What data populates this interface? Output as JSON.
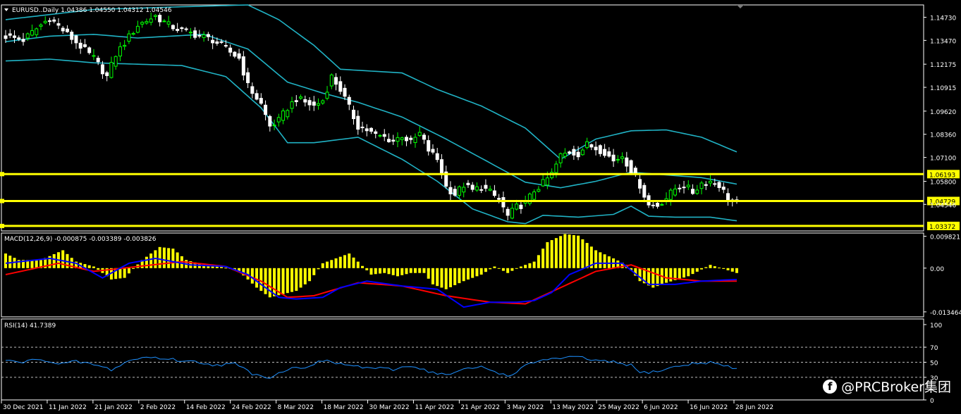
{
  "chart_data": [
    {
      "type": "candlestick",
      "title": "EURUSD..Daily",
      "ohlc_header": "1.04386 1.04550 1.04312 1.04546",
      "indicator": "Bollinger Bands",
      "ylim": [
        1.031,
        1.154
      ],
      "y_ticks": [
        "1.14730",
        "1.13470",
        "1.12175",
        "1.10915",
        "1.09620",
        "1.08360",
        "1.07100",
        "1.05800",
        "1.04546"
      ],
      "x_ticks": [
        "30 Dec 2021",
        "11 Jan 2022",
        "21 Jan 2022",
        "2 Feb 2022",
        "14 Feb 2022",
        "24 Feb 2022",
        "8 Mar 2022",
        "18 Mar 2022",
        "30 Mar 2022",
        "11 Apr 2022",
        "21 Apr 2022",
        "3 May 2022",
        "13 May 2022",
        "25 May 2022",
        "6 Jun 2022",
        "16 Jun 2022",
        "28 Jun 2022"
      ],
      "levels": [
        {
          "label": "1.06193",
          "value": 1.06193
        },
        {
          "label": "1.04729",
          "value": 1.04729
        },
        {
          "label": "1.03372",
          "value": 1.03372
        }
      ],
      "close_anchors": [
        [
          0,
          1.137
        ],
        [
          4,
          1.135
        ],
        [
          10,
          1.147
        ],
        [
          14,
          1.138
        ],
        [
          20,
          1.125
        ],
        [
          23,
          1.115
        ],
        [
          25,
          1.127
        ],
        [
          30,
          1.143
        ],
        [
          34,
          1.148
        ],
        [
          37,
          1.143
        ],
        [
          40,
          1.14
        ],
        [
          43,
          1.138
        ],
        [
          47,
          1.135
        ],
        [
          50,
          1.13
        ],
        [
          53,
          1.125
        ],
        [
          55,
          1.11
        ],
        [
          58,
          1.1
        ],
        [
          60,
          1.088
        ],
        [
          62,
          1.091
        ],
        [
          64,
          1.098
        ],
        [
          66,
          1.103
        ],
        [
          68,
          1.101
        ],
        [
          70,
          1.099
        ],
        [
          72,
          1.102
        ],
        [
          74,
          1.115
        ],
        [
          76,
          1.108
        ],
        [
          78,
          1.098
        ],
        [
          80,
          1.088
        ],
        [
          82,
          1.086
        ],
        [
          84,
          1.083
        ],
        [
          86,
          1.082
        ],
        [
          88,
          1.08
        ],
        [
          90,
          1.083
        ],
        [
          92,
          1.079
        ],
        [
          94,
          1.084
        ],
        [
          96,
          1.075
        ],
        [
          98,
          1.07
        ],
        [
          100,
          1.055
        ],
        [
          102,
          1.051
        ],
        [
          104,
          1.056
        ],
        [
          106,
          1.053
        ],
        [
          108,
          1.055
        ],
        [
          110,
          1.052
        ],
        [
          112,
          1.048
        ],
        [
          114,
          1.039
        ],
        [
          116,
          1.044
        ],
        [
          118,
          1.046
        ],
        [
          120,
          1.053
        ],
        [
          122,
          1.057
        ],
        [
          124,
          1.062
        ],
        [
          126,
          1.072
        ],
        [
          128,
          1.074
        ],
        [
          130,
          1.073
        ],
        [
          132,
          1.078
        ],
        [
          134,
          1.076
        ],
        [
          136,
          1.074
        ],
        [
          138,
          1.069
        ],
        [
          140,
          1.072
        ],
        [
          142,
          1.064
        ],
        [
          144,
          1.056
        ],
        [
          146,
          1.045
        ],
        [
          148,
          1.045
        ],
        [
          150,
          1.049
        ],
        [
          152,
          1.054
        ],
        [
          154,
          1.056
        ],
        [
          156,
          1.052
        ],
        [
          158,
          1.057
        ],
        [
          160,
          1.058
        ],
        [
          162,
          1.056
        ],
        [
          164,
          1.049
        ],
        [
          166,
          1.0455
        ]
      ],
      "bb_upper": [
        [
          0,
          1.146
        ],
        [
          20,
          1.1515
        ],
        [
          40,
          1.153
        ],
        [
          55,
          1.154
        ],
        [
          62,
          1.146
        ],
        [
          70,
          1.132
        ],
        [
          76,
          1.119
        ],
        [
          90,
          1.117
        ],
        [
          98,
          1.108
        ],
        [
          108,
          1.099
        ],
        [
          118,
          1.087
        ],
        [
          126,
          1.07
        ],
        [
          134,
          1.081
        ],
        [
          142,
          1.0855
        ],
        [
          150,
          1.086
        ],
        [
          158,
          1.082
        ],
        [
          166,
          1.074
        ]
      ],
      "bb_lower": [
        [
          0,
          1.1235
        ],
        [
          10,
          1.1245
        ],
        [
          20,
          1.1225
        ],
        [
          40,
          1.121
        ],
        [
          50,
          1.115
        ],
        [
          58,
          1.098
        ],
        [
          64,
          1.079
        ],
        [
          70,
          1.079
        ],
        [
          80,
          1.082
        ],
        [
          90,
          1.07
        ],
        [
          98,
          1.058
        ],
        [
          106,
          1.043
        ],
        [
          114,
          1.036
        ],
        [
          118,
          1.035
        ],
        [
          122,
          1.0395
        ],
        [
          130,
          1.0385
        ],
        [
          138,
          1.04
        ],
        [
          142,
          1.0445
        ],
        [
          146,
          1.039
        ],
        [
          152,
          1.0385
        ],
        [
          160,
          1.0385
        ],
        [
          166,
          1.0365
        ]
      ],
      "bb_middle": [
        [
          0,
          1.134
        ],
        [
          10,
          1.137
        ],
        [
          20,
          1.138
        ],
        [
          30,
          1.136
        ],
        [
          45,
          1.138
        ],
        [
          55,
          1.13
        ],
        [
          64,
          1.112
        ],
        [
          72,
          1.106
        ],
        [
          80,
          1.101
        ],
        [
          90,
          1.093
        ],
        [
          100,
          1.081
        ],
        [
          110,
          1.068
        ],
        [
          118,
          1.0575
        ],
        [
          126,
          1.0545
        ],
        [
          134,
          1.058
        ],
        [
          142,
          1.063
        ],
        [
          150,
          1.0615
        ],
        [
          158,
          1.06
        ],
        [
          166,
          1.0565
        ]
      ]
    },
    {
      "type": "macd",
      "title": "MACD(12,26,9) -0.000875 -0.003389 -0.003826",
      "ylim": [
        -0.015,
        0.0108
      ],
      "y_ticks": [
        "0.009821",
        "0.00",
        "-0.013464"
      ],
      "hist_anchors": [
        [
          0,
          0.0045
        ],
        [
          3,
          0.0025
        ],
        [
          8,
          0.0025
        ],
        [
          13,
          0.0055
        ],
        [
          16,
          0.002
        ],
        [
          20,
          0.0005
        ],
        [
          24,
          -0.0035
        ],
        [
          27,
          -0.003
        ],
        [
          31,
          0.0025
        ],
        [
          35,
          0.0065
        ],
        [
          38,
          0.006
        ],
        [
          41,
          0.0025
        ],
        [
          45,
          0.001
        ],
        [
          49,
          0.0005
        ],
        [
          53,
          -0.001
        ],
        [
          57,
          -0.006
        ],
        [
          60,
          -0.009
        ],
        [
          63,
          -0.008
        ],
        [
          66,
          -0.007
        ],
        [
          69,
          -0.004
        ],
        [
          72,
          0.0015
        ],
        [
          75,
          0.003
        ],
        [
          78,
          0.0045
        ],
        [
          80,
          0.002
        ],
        [
          83,
          -0.002
        ],
        [
          86,
          -0.0015
        ],
        [
          89,
          -0.0025
        ],
        [
          92,
          -0.0015
        ],
        [
          95,
          -0.0015
        ],
        [
          97,
          -0.005
        ],
        [
          100,
          -0.0065
        ],
        [
          104,
          -0.004
        ],
        [
          108,
          -0.002
        ],
        [
          111,
          0.0005
        ],
        [
          114,
          -0.0015
        ],
        [
          117,
          0.0005
        ],
        [
          120,
          0.002
        ],
        [
          123,
          0.008
        ],
        [
          127,
          0.0105
        ],
        [
          130,
          0.01
        ],
        [
          134,
          0.0055
        ],
        [
          138,
          0.003
        ],
        [
          141,
          0.001
        ],
        [
          144,
          -0.004
        ],
        [
          147,
          -0.006
        ],
        [
          150,
          -0.0045
        ],
        [
          155,
          -0.0025
        ],
        [
          160,
          0.001
        ],
        [
          166,
          -0.0015
        ]
      ],
      "macd_line": [
        [
          0,
          0.0015
        ],
        [
          10,
          0.003
        ],
        [
          16,
          0.0015
        ],
        [
          22,
          -0.003
        ],
        [
          28,
          0.0015
        ],
        [
          34,
          0.003
        ],
        [
          42,
          0.001
        ],
        [
          50,
          0.0005
        ],
        [
          55,
          -0.002
        ],
        [
          62,
          -0.009
        ],
        [
          66,
          -0.0095
        ],
        [
          72,
          -0.009
        ],
        [
          76,
          -0.006
        ],
        [
          82,
          -0.004
        ],
        [
          90,
          -0.0055
        ],
        [
          98,
          -0.0065
        ],
        [
          104,
          -0.012
        ],
        [
          110,
          -0.0105
        ],
        [
          116,
          -0.0105
        ],
        [
          120,
          -0.01
        ],
        [
          124,
          -0.0075
        ],
        [
          128,
          -0.002
        ],
        [
          134,
          0.0015
        ],
        [
          140,
          0.0015
        ],
        [
          146,
          -0.005
        ],
        [
          152,
          -0.005
        ],
        [
          158,
          -0.004
        ],
        [
          166,
          -0.0035
        ]
      ],
      "signal_line": [
        [
          0,
          -0.002
        ],
        [
          12,
          0.0015
        ],
        [
          20,
          -0.001
        ],
        [
          30,
          0.0005
        ],
        [
          40,
          0.002
        ],
        [
          50,
          0.0005
        ],
        [
          58,
          -0.004
        ],
        [
          64,
          -0.009
        ],
        [
          70,
          -0.0085
        ],
        [
          80,
          -0.0045
        ],
        [
          90,
          -0.0055
        ],
        [
          100,
          -0.0085
        ],
        [
          110,
          -0.0105
        ],
        [
          118,
          -0.011
        ],
        [
          126,
          -0.006
        ],
        [
          134,
          -0.001
        ],
        [
          142,
          0.001
        ],
        [
          150,
          -0.003
        ],
        [
          158,
          -0.004
        ],
        [
          166,
          -0.004
        ]
      ]
    },
    {
      "type": "rsi",
      "title": "RSI(14) 41.7389",
      "ylim": [
        0,
        100
      ],
      "y_ticks": [
        "100",
        "70",
        "50",
        "30",
        "0"
      ],
      "dashed_levels": [
        70,
        50,
        30
      ],
      "values": [
        [
          0,
          52
        ],
        [
          4,
          50
        ],
        [
          8,
          55
        ],
        [
          12,
          47
        ],
        [
          16,
          51
        ],
        [
          20,
          47
        ],
        [
          24,
          40
        ],
        [
          28,
          52
        ],
        [
          32,
          57
        ],
        [
          36,
          55
        ],
        [
          40,
          52
        ],
        [
          44,
          50
        ],
        [
          48,
          46
        ],
        [
          52,
          48
        ],
        [
          56,
          35
        ],
        [
          60,
          30
        ],
        [
          64,
          41
        ],
        [
          68,
          44
        ],
        [
          72,
          52
        ],
        [
          76,
          48
        ],
        [
          80,
          44
        ],
        [
          84,
          42
        ],
        [
          88,
          40
        ],
        [
          92,
          46
        ],
        [
          96,
          38
        ],
        [
          100,
          33
        ],
        [
          104,
          40
        ],
        [
          108,
          44
        ],
        [
          112,
          36
        ],
        [
          114,
          31
        ],
        [
          118,
          45
        ],
        [
          122,
          54
        ],
        [
          126,
          55
        ],
        [
          130,
          57
        ],
        [
          134,
          52
        ],
        [
          138,
          50
        ],
        [
          142,
          46
        ],
        [
          144,
          36
        ],
        [
          148,
          38
        ],
        [
          152,
          44
        ],
        [
          156,
          48
        ],
        [
          160,
          50
        ],
        [
          164,
          44
        ],
        [
          166,
          41
        ]
      ]
    }
  ],
  "watermark": {
    "text": "@PRCBroker集团",
    "icon": "facebook-icon",
    "glyph": "f"
  },
  "colors": {
    "bull": "#00ff00",
    "bear": "#ffffff",
    "bands": "#20b2c4",
    "level": "#ffff00",
    "macd_hist": "#ffff00",
    "macd": "#0000ff",
    "signal": "#ff0000",
    "rsi": "#1e90ff",
    "grid": "#ffffff",
    "background": "#000000"
  }
}
